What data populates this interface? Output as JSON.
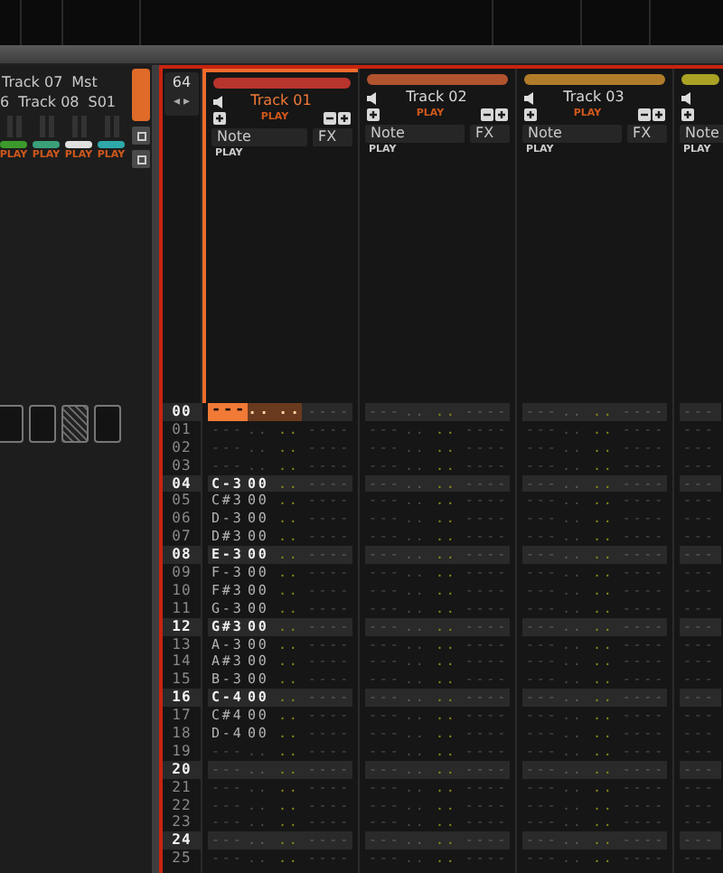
{
  "mixer": {
    "name_rows": [
      [
        "Track 07",
        "Mst"
      ],
      [
        "6",
        "Track 08",
        "S01"
      ]
    ],
    "strips": [
      {
        "color": "#3c9a2c",
        "state": "PLAY"
      },
      {
        "color": "#3aa07a",
        "state": "PLAY"
      },
      {
        "color": "#e0e0e0",
        "state": "PLAY"
      },
      {
        "color": "#2ea8a8",
        "state": "PLAY"
      }
    ],
    "slots": [
      {
        "kind": "empty"
      },
      {
        "kind": "empty"
      },
      {
        "kind": "hatched"
      },
      {
        "kind": "empty"
      }
    ]
  },
  "line_numbers": {
    "pattern_length": "64",
    "prev": "◂",
    "next": "▸"
  },
  "tracks": [
    {
      "name": "Track 01",
      "color": "#b8352e",
      "selected": true,
      "state": "PLAY",
      "columns": [
        "Note",
        "FX"
      ],
      "note_state": "PLAY"
    },
    {
      "name": "Track 02",
      "color": "#b0532e",
      "selected": false,
      "state": "PLAY",
      "columns": [
        "Note",
        "FX"
      ],
      "note_state": "PLAY"
    },
    {
      "name": "Track 03",
      "color": "#b07c2a",
      "selected": false,
      "state": "PLAY",
      "columns": [
        "Note",
        "FX"
      ],
      "note_state": "PLAY"
    },
    {
      "color": "#a9a224",
      "selected": false,
      "columns": [
        "Note"
      ],
      "note_state": "PLAY"
    }
  ],
  "rows": [
    {
      "num": "00",
      "beat": true,
      "cursor": true,
      "cells": [
        [
          "---",
          "..",
          "..",
          "----"
        ],
        [
          "---",
          "..",
          "..",
          "----"
        ],
        [
          "---",
          "..",
          "..",
          "----"
        ],
        [
          "---"
        ]
      ]
    },
    {
      "num": "01",
      "beat": false,
      "cursor": false,
      "cells": [
        [
          "---",
          "..",
          "..",
          "----"
        ],
        [
          "---",
          "..",
          "..",
          "----"
        ],
        [
          "---",
          "..",
          "..",
          "----"
        ],
        [
          "---"
        ]
      ]
    },
    {
      "num": "02",
      "beat": false,
      "cursor": false,
      "cells": [
        [
          "---",
          "..",
          "..",
          "----"
        ],
        [
          "---",
          "..",
          "..",
          "----"
        ],
        [
          "---",
          "..",
          "..",
          "----"
        ],
        [
          "---"
        ]
      ]
    },
    {
      "num": "03",
      "beat": false,
      "cursor": false,
      "cells": [
        [
          "---",
          "..",
          "..",
          "----"
        ],
        [
          "---",
          "..",
          "..",
          "----"
        ],
        [
          "---",
          "..",
          "..",
          "----"
        ],
        [
          "---"
        ]
      ]
    },
    {
      "num": "04",
      "beat": true,
      "cursor": false,
      "cells": [
        [
          "C-3",
          "00",
          "..",
          "----"
        ],
        [
          "---",
          "..",
          "..",
          "----"
        ],
        [
          "---",
          "..",
          "..",
          "----"
        ],
        [
          "---"
        ]
      ]
    },
    {
      "num": "05",
      "beat": false,
      "cursor": false,
      "cells": [
        [
          "C#3",
          "00",
          "..",
          "----"
        ],
        [
          "---",
          "..",
          "..",
          "----"
        ],
        [
          "---",
          "..",
          "..",
          "----"
        ],
        [
          "---"
        ]
      ]
    },
    {
      "num": "06",
      "beat": false,
      "cursor": false,
      "cells": [
        [
          "D-3",
          "00",
          "..",
          "----"
        ],
        [
          "---",
          "..",
          "..",
          "----"
        ],
        [
          "---",
          "..",
          "..",
          "----"
        ],
        [
          "---"
        ]
      ]
    },
    {
      "num": "07",
      "beat": false,
      "cursor": false,
      "cells": [
        [
          "D#3",
          "00",
          "..",
          "----"
        ],
        [
          "---",
          "..",
          "..",
          "----"
        ],
        [
          "---",
          "..",
          "..",
          "----"
        ],
        [
          "---"
        ]
      ]
    },
    {
      "num": "08",
      "beat": true,
      "cursor": false,
      "cells": [
        [
          "E-3",
          "00",
          "..",
          "----"
        ],
        [
          "---",
          "..",
          "..",
          "----"
        ],
        [
          "---",
          "..",
          "..",
          "----"
        ],
        [
          "---"
        ]
      ]
    },
    {
      "num": "09",
      "beat": false,
      "cursor": false,
      "cells": [
        [
          "F-3",
          "00",
          "..",
          "----"
        ],
        [
          "---",
          "..",
          "..",
          "----"
        ],
        [
          "---",
          "..",
          "..",
          "----"
        ],
        [
          "---"
        ]
      ]
    },
    {
      "num": "10",
      "beat": false,
      "cursor": false,
      "cells": [
        [
          "F#3",
          "00",
          "..",
          "----"
        ],
        [
          "---",
          "..",
          "..",
          "----"
        ],
        [
          "---",
          "..",
          "..",
          "----"
        ],
        [
          "---"
        ]
      ]
    },
    {
      "num": "11",
      "beat": false,
      "cursor": false,
      "cells": [
        [
          "G-3",
          "00",
          "..",
          "----"
        ],
        [
          "---",
          "..",
          "..",
          "----"
        ],
        [
          "---",
          "..",
          "..",
          "----"
        ],
        [
          "---"
        ]
      ]
    },
    {
      "num": "12",
      "beat": true,
      "cursor": false,
      "cells": [
        [
          "G#3",
          "00",
          "..",
          "----"
        ],
        [
          "---",
          "..",
          "..",
          "----"
        ],
        [
          "---",
          "..",
          "..",
          "----"
        ],
        [
          "---"
        ]
      ]
    },
    {
      "num": "13",
      "beat": false,
      "cursor": false,
      "cells": [
        [
          "A-3",
          "00",
          "..",
          "----"
        ],
        [
          "---",
          "..",
          "..",
          "----"
        ],
        [
          "---",
          "..",
          "..",
          "----"
        ],
        [
          "---"
        ]
      ]
    },
    {
      "num": "14",
      "beat": false,
      "cursor": false,
      "cells": [
        [
          "A#3",
          "00",
          "..",
          "----"
        ],
        [
          "---",
          "..",
          "..",
          "----"
        ],
        [
          "---",
          "..",
          "..",
          "----"
        ],
        [
          "---"
        ]
      ]
    },
    {
      "num": "15",
      "beat": false,
      "cursor": false,
      "cells": [
        [
          "B-3",
          "00",
          "..",
          "----"
        ],
        [
          "---",
          "..",
          "..",
          "----"
        ],
        [
          "---",
          "..",
          "..",
          "----"
        ],
        [
          "---"
        ]
      ]
    },
    {
      "num": "16",
      "beat": true,
      "cursor": false,
      "cells": [
        [
          "C-4",
          "00",
          "..",
          "----"
        ],
        [
          "---",
          "..",
          "..",
          "----"
        ],
        [
          "---",
          "..",
          "..",
          "----"
        ],
        [
          "---"
        ]
      ]
    },
    {
      "num": "17",
      "beat": false,
      "cursor": false,
      "cells": [
        [
          "C#4",
          "00",
          "..",
          "----"
        ],
        [
          "---",
          "..",
          "..",
          "----"
        ],
        [
          "---",
          "..",
          "..",
          "----"
        ],
        [
          "---"
        ]
      ]
    },
    {
      "num": "18",
      "beat": false,
      "cursor": false,
      "cells": [
        [
          "D-4",
          "00",
          "..",
          "----"
        ],
        [
          "---",
          "..",
          "..",
          "----"
        ],
        [
          "---",
          "..",
          "..",
          "----"
        ],
        [
          "---"
        ]
      ]
    },
    {
      "num": "19",
      "beat": false,
      "cursor": false,
      "cells": [
        [
          "---",
          "..",
          "..",
          "----"
        ],
        [
          "---",
          "..",
          "..",
          "----"
        ],
        [
          "---",
          "..",
          "..",
          "----"
        ],
        [
          "---"
        ]
      ]
    },
    {
      "num": "20",
      "beat": true,
      "cursor": false,
      "cells": [
        [
          "---",
          "..",
          "..",
          "----"
        ],
        [
          "---",
          "..",
          "..",
          "----"
        ],
        [
          "---",
          "..",
          "..",
          "----"
        ],
        [
          "---"
        ]
      ]
    },
    {
      "num": "21",
      "beat": false,
      "cursor": false,
      "cells": [
        [
          "---",
          "..",
          "..",
          "----"
        ],
        [
          "---",
          "..",
          "..",
          "----"
        ],
        [
          "---",
          "..",
          "..",
          "----"
        ],
        [
          "---"
        ]
      ]
    },
    {
      "num": "22",
      "beat": false,
      "cursor": false,
      "cells": [
        [
          "---",
          "..",
          "..",
          "----"
        ],
        [
          "---",
          "..",
          "..",
          "----"
        ],
        [
          "---",
          "..",
          "..",
          "----"
        ],
        [
          "---"
        ]
      ]
    },
    {
      "num": "23",
      "beat": false,
      "cursor": false,
      "cells": [
        [
          "---",
          "..",
          "..",
          "----"
        ],
        [
          "---",
          "..",
          "..",
          "----"
        ],
        [
          "---",
          "..",
          "..",
          "----"
        ],
        [
          "---"
        ]
      ]
    },
    {
      "num": "24",
      "beat": true,
      "cursor": false,
      "cells": [
        [
          "---",
          "..",
          "..",
          "----"
        ],
        [
          "---",
          "..",
          "..",
          "----"
        ],
        [
          "---",
          "..",
          "..",
          "----"
        ],
        [
          "---"
        ]
      ]
    },
    {
      "num": "25",
      "beat": false,
      "cursor": false,
      "cells": [
        [
          "---",
          "..",
          "..",
          "----"
        ],
        [
          "---",
          "..",
          "..",
          "----"
        ],
        [
          "---",
          "..",
          "..",
          "----"
        ],
        [
          "---"
        ]
      ]
    }
  ]
}
